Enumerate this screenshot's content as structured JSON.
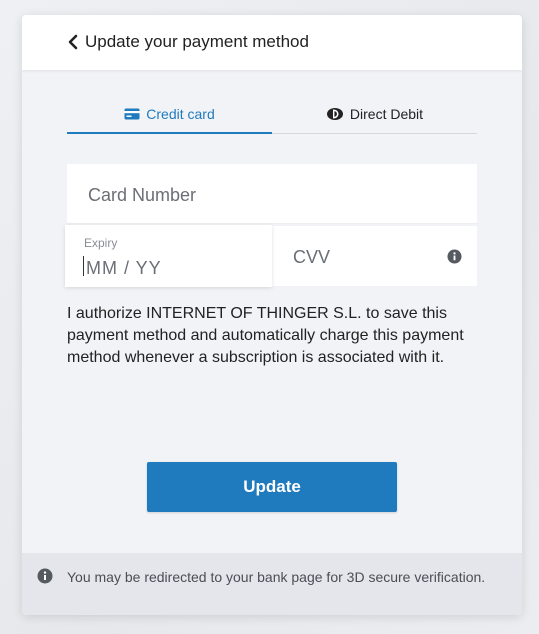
{
  "header": {
    "back_label": "Update your payment method"
  },
  "tabs": [
    {
      "label": "Credit card",
      "active": true
    },
    {
      "label": "Direct Debit",
      "active": false
    }
  ],
  "form": {
    "card_number_placeholder": "Card Number",
    "expiry_label": "Expiry",
    "expiry_placeholder": "MM / YY",
    "cvv_placeholder": "CVV"
  },
  "authorization_text": "I authorize INTERNET OF THINGER S.L. to save this payment method and automatically charge this payment method whenever a subscription is associated with it.",
  "update_label": "Update",
  "footer_note": "You may be redirected to your bank page for 3D secure verification.",
  "colors": {
    "accent": "#1f7bbd",
    "panel": "#f2f3f7",
    "footer": "#e4e6eb"
  },
  "icons": {
    "back": "chevron-left-icon",
    "credit_card": "credit-card-icon",
    "direct_debit": "direct-debit-icon",
    "cvv_info": "info-icon",
    "footer_info": "info-icon"
  }
}
